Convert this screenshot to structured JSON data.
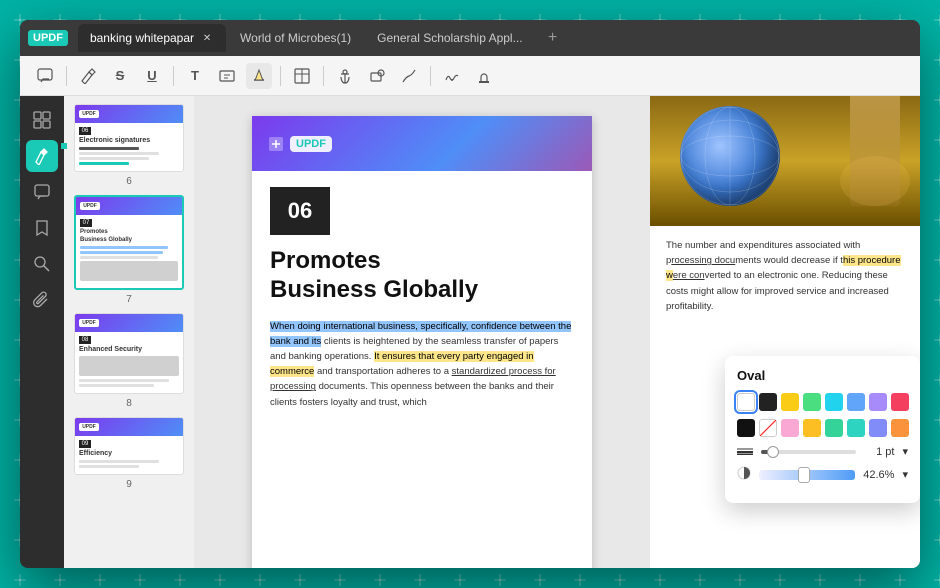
{
  "background": {
    "color": "#00b4a6"
  },
  "app": {
    "tabs": [
      {
        "label": "banking whitepapar",
        "active": true,
        "has_close": true
      },
      {
        "label": "World of Microbes(1)",
        "active": false,
        "has_close": false
      },
      {
        "label": "General Scholarship Appl...",
        "active": false,
        "has_close": false
      }
    ],
    "tab_add_label": "+",
    "logo": "UPDF"
  },
  "toolbar": {
    "icons": [
      "comment",
      "pen",
      "strikethrough",
      "underline",
      "text",
      "text-box",
      "text-alt",
      "table",
      "anchor",
      "shape",
      "oval",
      "highlight",
      "signature",
      "stamp"
    ]
  },
  "left_sidebar": {
    "tools": [
      {
        "id": "thumbnail",
        "icon": "⊞",
        "active": false
      },
      {
        "id": "annotation",
        "icon": "✏",
        "active": true
      },
      {
        "id": "comment",
        "icon": "💬",
        "active": false
      },
      {
        "id": "bookmark",
        "icon": "🔖",
        "active": false
      },
      {
        "id": "search",
        "icon": "🔍",
        "active": false
      },
      {
        "id": "attachment",
        "icon": "📎",
        "active": false
      }
    ]
  },
  "thumbnails": [
    {
      "page_num": "6",
      "title": "Electronic signatures",
      "selected": false
    },
    {
      "page_num": "7",
      "title": "Promotes Business Globally",
      "selected": true
    },
    {
      "page_num": "8",
      "title": "Enhanced Security",
      "selected": false
    },
    {
      "page_num": "9",
      "title": "Efficiency",
      "selected": false
    }
  ],
  "document": {
    "chapter_num": "06",
    "title_line1": "Promotes",
    "title_line2": "Business Globally",
    "body_text_1": "When doing international business, specifically, confidence between the bank and its clients is heightened by the seamless transfer of papers and banking operations. It ensures that every party engaged in commerce and transportation adheres to a standardized process for processing documents. This openness between the banks and their clients fosters loyalty and trust, which",
    "body_text_highlighted_1": "When doing international business, specifically, confidence between the bank and its",
    "body_text_yellow_1": "It ensures that every party engaged in commerce",
    "body_text_underline_1": "standardized process for processing"
  },
  "right_panel": {
    "body_text": "The number and expenditures associated with processing documents would decrease if this procedure were converted to an electronic one. Reducing these costs might allow for improved service and increased profitability.",
    "highlight_word": "procedure"
  },
  "oval_popup": {
    "title": "Oval",
    "color_row1": [
      {
        "color": "#ffffff",
        "type": "white"
      },
      {
        "color": "#222222",
        "type": "dark"
      },
      {
        "color": "#facc15",
        "type": "yellow"
      },
      {
        "color": "#4ade80",
        "type": "green"
      },
      {
        "color": "#22d3ee",
        "type": "cyan"
      },
      {
        "color": "#60a5fa",
        "type": "blue"
      },
      {
        "color": "#a78bfa",
        "type": "purple"
      },
      {
        "color": "#f43f5e",
        "type": "red"
      }
    ],
    "color_row2": [
      {
        "color": "#111111",
        "type": "black"
      },
      {
        "color": "transparent",
        "type": "transparent"
      },
      {
        "color": "#f9a8d4",
        "type": "pink"
      },
      {
        "color": "#fbbf24",
        "type": "amber"
      },
      {
        "color": "#34d399",
        "type": "emerald"
      },
      {
        "color": "#2dd4bf",
        "type": "teal"
      },
      {
        "color": "#818cf8",
        "type": "indigo"
      },
      {
        "color": "#fb923c",
        "type": "orange"
      }
    ],
    "stroke_width_label": "—",
    "stroke_value": "1 pt",
    "opacity_icon": "◑",
    "opacity_value": "42.6%",
    "stroke_slider_pct": 10,
    "opacity_slider_pct": 43
  }
}
